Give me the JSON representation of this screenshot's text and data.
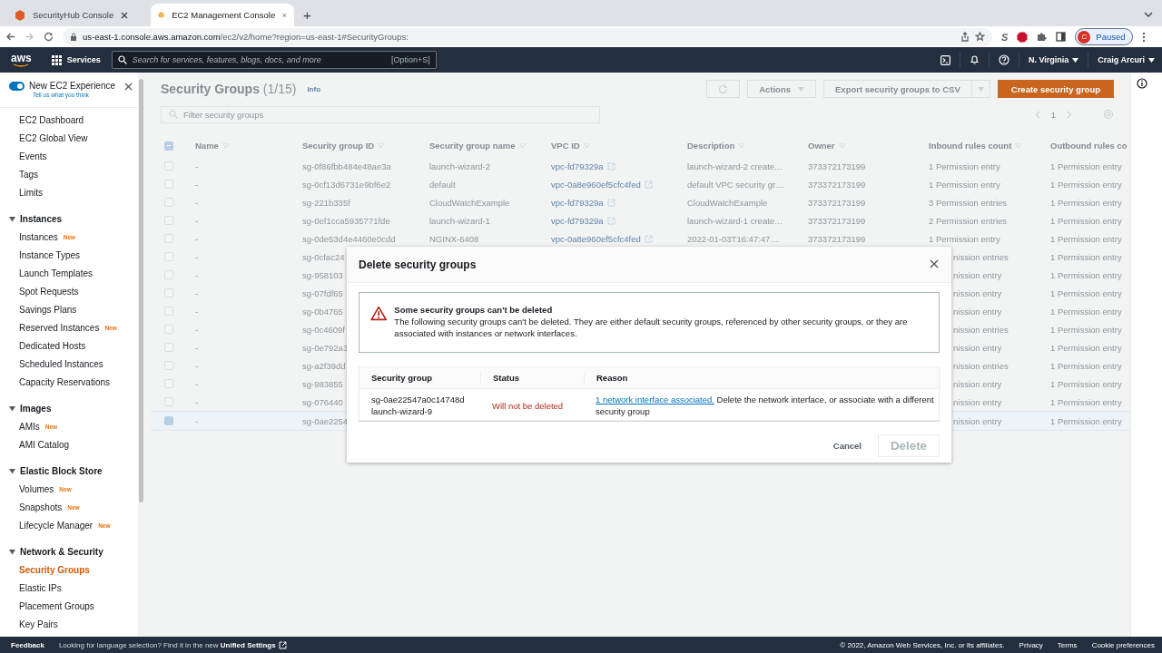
{
  "browser": {
    "tabs": [
      {
        "title": "SecurityHub Console",
        "selected": false,
        "kind": "hexagon"
      },
      {
        "title": "EC2 Management Console",
        "selected": true,
        "kind": "cube"
      }
    ],
    "new_tab": "+",
    "url_host": "us-east-1.console.aws.amazon.com",
    "url_path": "/ec2/v2/home?region=us-east-1#SecurityGroups:",
    "extension_letter": "S",
    "profile_initial": "C",
    "profile_status": "Paused"
  },
  "nav": {
    "logo": "aws",
    "services": "Services",
    "search_placeholder": "Search for services, features, blogs, docs, and more",
    "search_shortcut": "[Option+S]",
    "region": "N. Virginia",
    "user": "Craig Arcuri"
  },
  "sidebar": {
    "experience": {
      "label": "New EC2 Experience",
      "sublabel": "Tell us what you think",
      "on": true
    },
    "items": [
      {
        "label": "EC2 Dashboard",
        "selected": false
      },
      {
        "label": "EC2 Global View",
        "selected": false
      },
      {
        "label": "Events",
        "selected": false
      },
      {
        "label": "Tags",
        "selected": false
      },
      {
        "label": "Limits",
        "selected": false
      }
    ],
    "sections": [
      {
        "title": "Instances",
        "expanded": true,
        "items": [
          {
            "label": "Instances",
            "badge": "New",
            "selected": false
          },
          {
            "label": "Instance Types",
            "selected": false
          },
          {
            "label": "Launch Templates",
            "selected": false
          },
          {
            "label": "Spot Requests",
            "selected": false
          },
          {
            "label": "Savings Plans",
            "selected": false
          },
          {
            "label": "Reserved Instances",
            "badge": "New",
            "selected": false
          },
          {
            "label": "Dedicated Hosts",
            "selected": false
          },
          {
            "label": "Scheduled Instances",
            "selected": false
          },
          {
            "label": "Capacity Reservations",
            "selected": false
          }
        ]
      },
      {
        "title": "Images",
        "expanded": true,
        "items": [
          {
            "label": "AMIs",
            "badge": "New",
            "selected": false
          },
          {
            "label": "AMI Catalog",
            "selected": false
          }
        ]
      },
      {
        "title": "Elastic Block Store",
        "expanded": true,
        "items": [
          {
            "label": "Volumes",
            "badge": "New",
            "selected": false
          },
          {
            "label": "Snapshots",
            "badge": "New",
            "selected": false
          },
          {
            "label": "Lifecycle Manager",
            "badge": "New",
            "selected": false
          }
        ]
      },
      {
        "title": "Network & Security",
        "expanded": true,
        "items": [
          {
            "label": "Security Groups",
            "selected": true
          },
          {
            "label": "Elastic IPs",
            "selected": false
          },
          {
            "label": "Placement Groups",
            "selected": false
          },
          {
            "label": "Key Pairs",
            "selected": false
          }
        ]
      }
    ]
  },
  "page": {
    "title": "Security Groups",
    "count": "(1/15)",
    "info": "Info",
    "actions": "Actions",
    "export": "Export security groups to CSV",
    "create": "Create security group",
    "filter_placeholder": "Filter security groups",
    "page_number": "1"
  },
  "table": {
    "partially_selected": true,
    "columns": [
      "Name",
      "Security group ID",
      "Security group name",
      "VPC ID",
      "Description",
      "Owner",
      "Inbound rules count",
      "Outbound rules co"
    ],
    "rows": [
      {
        "checked": false,
        "cells": [
          "-",
          "sg-0f86fbb484e48ae3a",
          "launch-wizard-2",
          "vpc-fd79329a",
          "launch-wizard-2 create…",
          "373372173199",
          "1 Permission entry",
          "1 Permission entry"
        ]
      },
      {
        "checked": false,
        "cells": [
          "-",
          "sg-0cf13d6731e9bf6e2",
          "default",
          "vpc-0a8e960ef5cfc4fed",
          "default VPC security gr…",
          "373372173199",
          "1 Permission entry",
          "1 Permission entry"
        ]
      },
      {
        "checked": false,
        "cells": [
          "-",
          "sg-221b335f",
          "CloudWatchExample",
          "vpc-fd79329a",
          "CloudWatchExample",
          "373372173199",
          "3 Permission entries",
          "1 Permission entry"
        ]
      },
      {
        "checked": false,
        "cells": [
          "-",
          "sg-0ef1cca5935771fde",
          "launch-wizard-1",
          "vpc-fd79329a",
          "launch-wizard-1 create…",
          "373372173199",
          "2 Permission entries",
          "1 Permission entry"
        ]
      },
      {
        "checked": false,
        "cells": [
          "-",
          "sg-0de53d4e4460e0cdd",
          "NGINX-6408",
          "vpc-0a8e960ef5cfc4fed",
          "2022-01-03T16:47:47…",
          "373372173199",
          "1 Permission entry",
          "1 Permission entry"
        ]
      },
      {
        "checked": false,
        "cells": [
          "-",
          "sg-0cfac24",
          null,
          null,
          null,
          null,
          "nission entries",
          "1 Permission entry"
        ]
      },
      {
        "checked": false,
        "cells": [
          "-",
          "sg-958103",
          null,
          null,
          null,
          null,
          "nission entry",
          "1 Permission entry"
        ]
      },
      {
        "checked": false,
        "cells": [
          "-",
          "sg-07fdf65",
          null,
          null,
          null,
          null,
          "nission entry",
          "1 Permission entry"
        ]
      },
      {
        "checked": false,
        "cells": [
          "-",
          "sg-0b4765",
          null,
          null,
          null,
          null,
          "nission entry",
          "1 Permission entry"
        ]
      },
      {
        "checked": false,
        "cells": [
          "-",
          "sg-0c4609f",
          null,
          null,
          null,
          null,
          "nission entries",
          "1 Permission entry"
        ]
      },
      {
        "checked": false,
        "cells": [
          "-",
          "sg-0e792a3",
          null,
          null,
          null,
          null,
          "nission entry",
          "1 Permission entry"
        ]
      },
      {
        "checked": false,
        "cells": [
          "-",
          "sg-a2f39dd",
          null,
          null,
          null,
          null,
          "nission entries",
          "1 Permission entry"
        ]
      },
      {
        "checked": false,
        "cells": [
          "-",
          "sg-983855",
          null,
          null,
          null,
          null,
          "nission entry",
          "1 Permission entry"
        ]
      },
      {
        "checked": false,
        "cells": [
          "-",
          "sg-076440",
          null,
          null,
          null,
          null,
          "nission entry",
          "1 Permission entry"
        ]
      },
      {
        "checked": true,
        "cells": [
          "-",
          "sg-0ae2254",
          null,
          null,
          null,
          null,
          "nission entry",
          "1 Permission entry"
        ]
      }
    ]
  },
  "modal": {
    "title": "Delete security groups",
    "alert_title": "Some security groups can't be deleted",
    "alert_text": "The following security groups can't be deleted. They are either default security groups, referenced by other security groups, or they are associated with instances or network interfaces.",
    "columns": [
      "Security group",
      "Status",
      "Reason"
    ],
    "rows": [
      {
        "id": "sg-0ae22547a0c14748d",
        "name": "launch-wizard-9",
        "status": "Will not be deleted",
        "reason_link": "1 network interface associated.",
        "reason_text": "Delete the network interface, or associate with a different security group"
      }
    ],
    "cancel": "Cancel",
    "delete": {
      "label": "Delete",
      "disabled": true
    }
  },
  "footer": {
    "feedback": "Feedback",
    "message": "Looking for language selection? Find it in the new",
    "settings_link": "Unified Settings",
    "copyright": "© 2022, Amazon Web Services, Inc. or its affiliates.",
    "links": [
      "Privacy",
      "Terms",
      "Cookie preferences"
    ]
  }
}
